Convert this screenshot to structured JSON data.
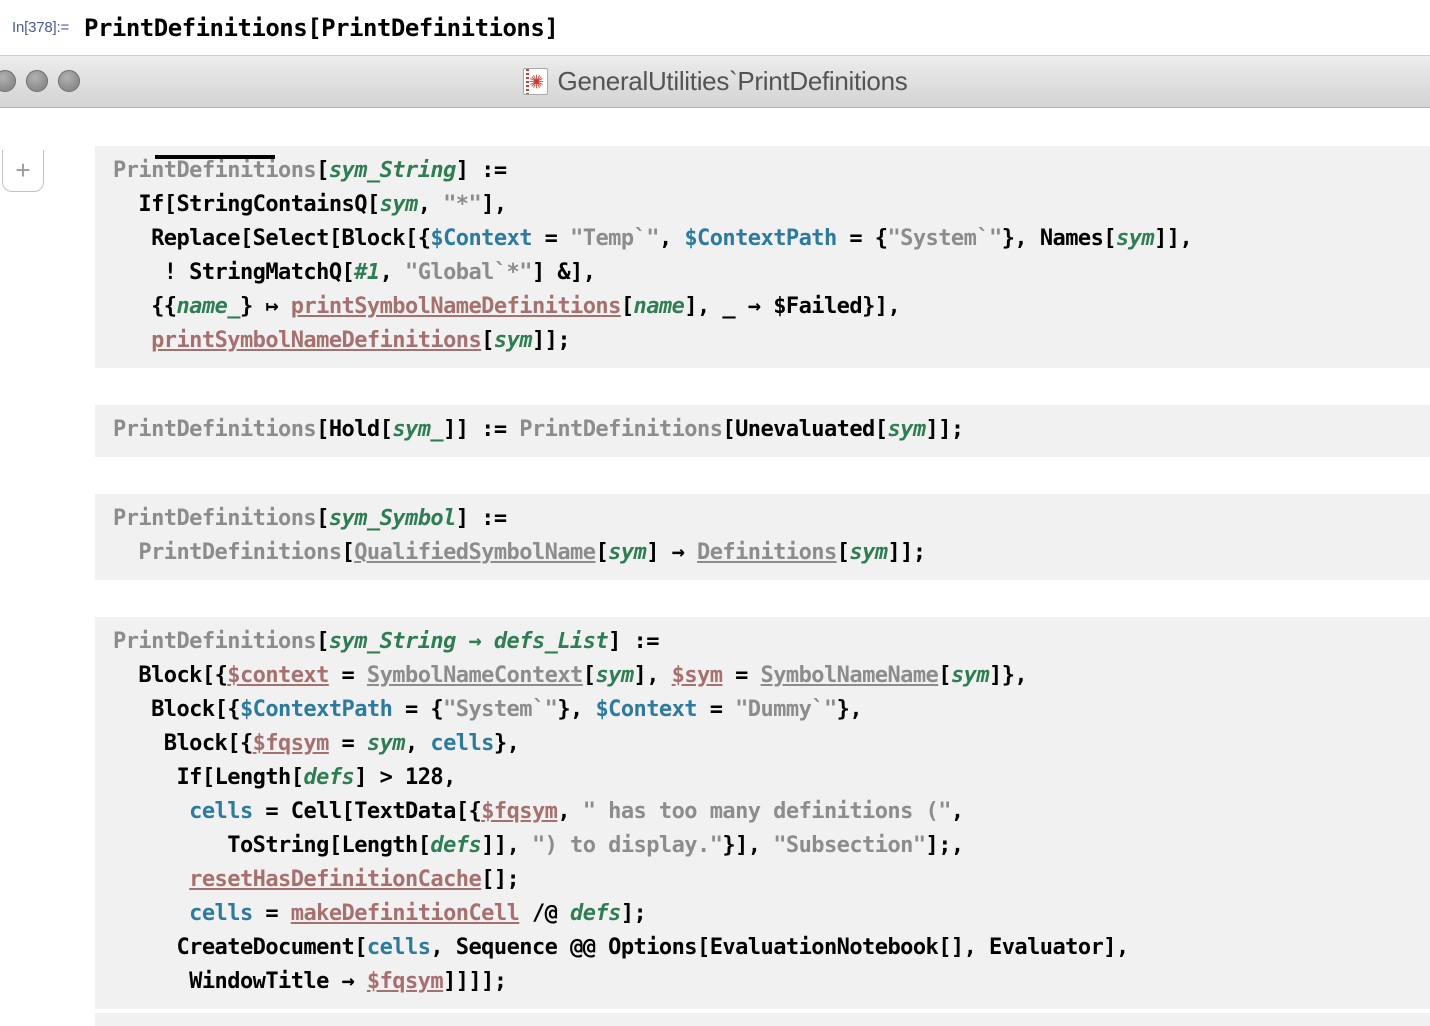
{
  "input_cell": {
    "label": "In[378]:=",
    "code": "PrintDefinitions[PrintDefinitions]"
  },
  "window": {
    "title": "GeneralUtilities`PrintDefinitions",
    "icon": "wolfram-notebook-icon",
    "buttons": [
      "close-button",
      "minimize-button",
      "zoom-button"
    ],
    "insert_cell_label": "+"
  },
  "definitions": [
    {
      "id": "definition-1",
      "lines": [
        [
          {
            "t": "PrintDefinitions",
            "c": "gry"
          },
          {
            "t": "[",
            "c": "blk"
          },
          {
            "t": "sym_String",
            "c": "grn"
          },
          {
            "t": "] := ",
            "c": "blk"
          }
        ],
        [
          {
            "t": "  If",
            "c": "blk"
          },
          {
            "t": "[",
            "c": "blk"
          },
          {
            "t": "StringContainsQ",
            "c": "blk"
          },
          {
            "t": "[",
            "c": "blk"
          },
          {
            "t": "sym",
            "c": "grn"
          },
          {
            "t": ", ",
            "c": "blk"
          },
          {
            "t": "\"*\"",
            "c": "str"
          },
          {
            "t": "],",
            "c": "blk"
          }
        ],
        [
          {
            "t": "   Replace",
            "c": "blk"
          },
          {
            "t": "[",
            "c": "blk"
          },
          {
            "t": "Select",
            "c": "blk"
          },
          {
            "t": "[",
            "c": "blk"
          },
          {
            "t": "Block",
            "c": "blk"
          },
          {
            "t": "[{",
            "c": "blk"
          },
          {
            "t": "$Context",
            "c": "tel"
          },
          {
            "t": " = ",
            "c": "blk"
          },
          {
            "t": "\"Temp`\"",
            "c": "str"
          },
          {
            "t": ", ",
            "c": "blk"
          },
          {
            "t": "$ContextPath",
            "c": "tel"
          },
          {
            "t": " = {",
            "c": "blk"
          },
          {
            "t": "\"System`\"",
            "c": "str"
          },
          {
            "t": "}, ",
            "c": "blk"
          },
          {
            "t": "Names",
            "c": "blk"
          },
          {
            "t": "[",
            "c": "blk"
          },
          {
            "t": "sym",
            "c": "grn"
          },
          {
            "t": "]],",
            "c": "blk"
          }
        ],
        [
          {
            "t": "    ! ",
            "c": "blk"
          },
          {
            "t": "StringMatchQ",
            "c": "blk"
          },
          {
            "t": "[",
            "c": "blk"
          },
          {
            "t": "#1",
            "c": "grn"
          },
          {
            "t": ", ",
            "c": "blk"
          },
          {
            "t": "\"Global`*\"",
            "c": "str"
          },
          {
            "t": "] &],",
            "c": "blk"
          }
        ],
        [
          {
            "t": "   {{",
            "c": "blk"
          },
          {
            "t": "name_",
            "c": "grn"
          },
          {
            "t": "} ↦ ",
            "c": "blk"
          },
          {
            "t": "printSymbolNameDefinitions",
            "c": "mve"
          },
          {
            "t": "[",
            "c": "blk"
          },
          {
            "t": "name",
            "c": "grn"
          },
          {
            "t": "], _ → ",
            "c": "blk"
          },
          {
            "t": "$Failed",
            "c": "blk"
          },
          {
            "t": "}],",
            "c": "blk"
          }
        ],
        [
          {
            "t": "   ",
            "c": "blk"
          },
          {
            "t": "printSymbolNameDefinitions",
            "c": "mve"
          },
          {
            "t": "[",
            "c": "blk"
          },
          {
            "t": "sym",
            "c": "grn"
          },
          {
            "t": "]];",
            "c": "blk"
          }
        ]
      ]
    },
    {
      "id": "definition-2",
      "lines": [
        [
          {
            "t": "PrintDefinitions",
            "c": "gry"
          },
          {
            "t": "[",
            "c": "blk"
          },
          {
            "t": "Hold",
            "c": "blk"
          },
          {
            "t": "[",
            "c": "blk"
          },
          {
            "t": "sym_",
            "c": "grn"
          },
          {
            "t": "]] := ",
            "c": "blk"
          },
          {
            "t": "PrintDefinitions",
            "c": "gry"
          },
          {
            "t": "[",
            "c": "blk"
          },
          {
            "t": "Unevaluated",
            "c": "blk"
          },
          {
            "t": "[",
            "c": "blk"
          },
          {
            "t": "sym",
            "c": "grn"
          },
          {
            "t": "]];",
            "c": "blk"
          }
        ]
      ]
    },
    {
      "id": "definition-3",
      "lines": [
        [
          {
            "t": "PrintDefinitions",
            "c": "gry"
          },
          {
            "t": "[",
            "c": "blk"
          },
          {
            "t": "sym_Symbol",
            "c": "grn"
          },
          {
            "t": "] := ",
            "c": "blk"
          }
        ],
        [
          {
            "t": "  PrintDefinitions",
            "c": "gry"
          },
          {
            "t": "[",
            "c": "blk"
          },
          {
            "t": "QualifiedSymbolName",
            "c": "gru"
          },
          {
            "t": "[",
            "c": "blk"
          },
          {
            "t": "sym",
            "c": "grn"
          },
          {
            "t": "] → ",
            "c": "blk"
          },
          {
            "t": "Definitions",
            "c": "gru"
          },
          {
            "t": "[",
            "c": "blk"
          },
          {
            "t": "sym",
            "c": "grn"
          },
          {
            "t": "]];",
            "c": "blk"
          }
        ]
      ]
    },
    {
      "id": "definition-4",
      "lines": [
        [
          {
            "t": "PrintDefinitions",
            "c": "gry"
          },
          {
            "t": "[",
            "c": "blk"
          },
          {
            "t": "sym_String → defs_List",
            "c": "grn"
          },
          {
            "t": "] := ",
            "c": "blk"
          }
        ],
        [
          {
            "t": "  Block",
            "c": "blk"
          },
          {
            "t": "[{",
            "c": "blk"
          },
          {
            "t": "$context",
            "c": "mve"
          },
          {
            "t": " = ",
            "c": "blk"
          },
          {
            "t": "SymbolNameContext",
            "c": "gru"
          },
          {
            "t": "[",
            "c": "blk"
          },
          {
            "t": "sym",
            "c": "grn"
          },
          {
            "t": "], ",
            "c": "blk"
          },
          {
            "t": "$sym",
            "c": "mve"
          },
          {
            "t": " = ",
            "c": "blk"
          },
          {
            "t": "SymbolNameName",
            "c": "gru"
          },
          {
            "t": "[",
            "c": "blk"
          },
          {
            "t": "sym",
            "c": "grn"
          },
          {
            "t": "]},",
            "c": "blk"
          }
        ],
        [
          {
            "t": "   Block",
            "c": "blk"
          },
          {
            "t": "[{",
            "c": "blk"
          },
          {
            "t": "$ContextPath",
            "c": "tel"
          },
          {
            "t": " = {",
            "c": "blk"
          },
          {
            "t": "\"System`\"",
            "c": "str"
          },
          {
            "t": "}, ",
            "c": "blk"
          },
          {
            "t": "$Context",
            "c": "tel"
          },
          {
            "t": " = ",
            "c": "blk"
          },
          {
            "t": "\"Dummy`\"",
            "c": "str"
          },
          {
            "t": "},",
            "c": "blk"
          }
        ],
        [
          {
            "t": "    Block",
            "c": "blk"
          },
          {
            "t": "[{",
            "c": "blk"
          },
          {
            "t": "$fqsym",
            "c": "mve"
          },
          {
            "t": " = ",
            "c": "blk"
          },
          {
            "t": "sym",
            "c": "grn"
          },
          {
            "t": ", ",
            "c": "blk"
          },
          {
            "t": "cells",
            "c": "tel"
          },
          {
            "t": "},",
            "c": "blk"
          }
        ],
        [
          {
            "t": "     If",
            "c": "blk"
          },
          {
            "t": "[",
            "c": "blk"
          },
          {
            "t": "Length",
            "c": "blk"
          },
          {
            "t": "[",
            "c": "blk"
          },
          {
            "t": "defs",
            "c": "grn"
          },
          {
            "t": "] > 128,",
            "c": "blk"
          }
        ],
        [
          {
            "t": "      ",
            "c": "blk"
          },
          {
            "t": "cells",
            "c": "tel"
          },
          {
            "t": " = ",
            "c": "blk"
          },
          {
            "t": "Cell",
            "c": "blk"
          },
          {
            "t": "[",
            "c": "blk"
          },
          {
            "t": "TextData",
            "c": "blk"
          },
          {
            "t": "[{",
            "c": "blk"
          },
          {
            "t": "$fqsym",
            "c": "mve"
          },
          {
            "t": ", ",
            "c": "blk"
          },
          {
            "t": "\" has too many definitions (\"",
            "c": "str"
          },
          {
            "t": ",",
            "c": "blk"
          }
        ],
        [
          {
            "t": "         ",
            "c": "blk"
          },
          {
            "t": "ToString",
            "c": "blk"
          },
          {
            "t": "[",
            "c": "blk"
          },
          {
            "t": "Length",
            "c": "blk"
          },
          {
            "t": "[",
            "c": "blk"
          },
          {
            "t": "defs",
            "c": "grn"
          },
          {
            "t": "]], ",
            "c": "blk"
          },
          {
            "t": "\") to display.\"",
            "c": "str"
          },
          {
            "t": "}], ",
            "c": "blk"
          },
          {
            "t": "\"Subsection\"",
            "c": "str"
          },
          {
            "t": "];,",
            "c": "blk"
          }
        ],
        [
          {
            "t": "      ",
            "c": "blk"
          },
          {
            "t": "resetHasDefinitionCache",
            "c": "mve"
          },
          {
            "t": "[];",
            "c": "blk"
          }
        ],
        [
          {
            "t": "      ",
            "c": "blk"
          },
          {
            "t": "cells",
            "c": "tel"
          },
          {
            "t": " = ",
            "c": "blk"
          },
          {
            "t": "makeDefinitionCell",
            "c": "mve"
          },
          {
            "t": " /@ ",
            "c": "blk"
          },
          {
            "t": "defs",
            "c": "grn"
          },
          {
            "t": "];",
            "c": "blk"
          }
        ],
        [
          {
            "t": "     CreateDocument",
            "c": "blk"
          },
          {
            "t": "[",
            "c": "blk"
          },
          {
            "t": "cells",
            "c": "tel"
          },
          {
            "t": ", ",
            "c": "blk"
          },
          {
            "t": "Sequence @@ Options",
            "c": "blk"
          },
          {
            "t": "[",
            "c": "blk"
          },
          {
            "t": "EvaluationNotebook",
            "c": "blk"
          },
          {
            "t": "[], ",
            "c": "blk"
          },
          {
            "t": "Evaluator",
            "c": "blk"
          },
          {
            "t": "],",
            "c": "blk"
          }
        ],
        [
          {
            "t": "      WindowTitle → ",
            "c": "blk"
          },
          {
            "t": "$fqsym",
            "c": "mve"
          },
          {
            "t": "]]]];",
            "c": "blk"
          }
        ]
      ]
    }
  ],
  "colors": {
    "cell_background": "#f1f1f1",
    "notebook_background": "#ffffff",
    "in_label": "#4a5b9e",
    "global_symbol": "#8c8c8c",
    "pattern": "#2f7d52",
    "system_variable": "#2c7b9e",
    "private_symbol": "#a6706f",
    "titlebar": "#dedede"
  }
}
